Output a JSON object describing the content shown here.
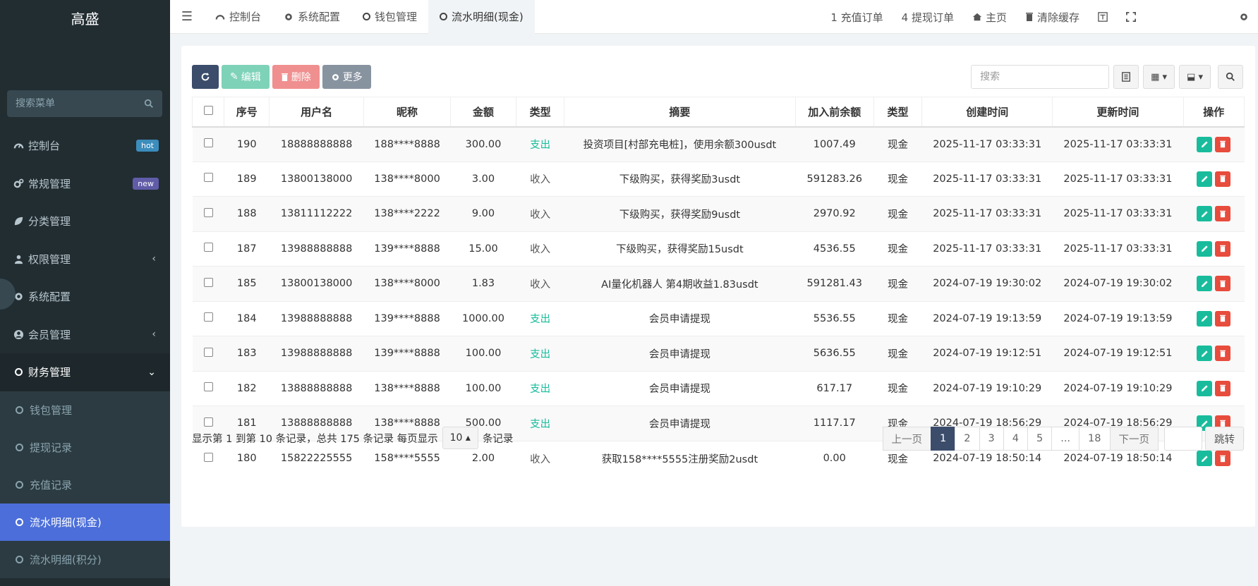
{
  "sidebar": {
    "brand": "高盛",
    "search_placeholder": "搜索菜单",
    "items": [
      {
        "label": "控制台",
        "badge": "hot",
        "badge_color": "#3c8dbc"
      },
      {
        "label": "常规管理",
        "badge": "new",
        "badge_color": "#605ca8"
      },
      {
        "label": "分类管理"
      },
      {
        "label": "权限管理"
      },
      {
        "label": "系统配置"
      },
      {
        "label": "会员管理"
      },
      {
        "label": "财务管理"
      }
    ],
    "submenu": [
      {
        "label": "钱包管理"
      },
      {
        "label": "提现记录"
      },
      {
        "label": "充值记录"
      },
      {
        "label": "流水明细(现金)"
      },
      {
        "label": "流水明细(积分)"
      }
    ]
  },
  "topnav": {
    "tabs": [
      "控制台",
      "系统配置",
      "钱包管理",
      "流水明细(现金)"
    ],
    "right": {
      "recharge": "1 充值订单",
      "withdraw": "4 提现订单",
      "home": "主页",
      "clear_cache": "清除缓存"
    }
  },
  "toolbar": {
    "edit": "编辑",
    "delete": "删除",
    "more": "更多",
    "search_placeholder": "搜索"
  },
  "table": {
    "headers": [
      "序号",
      "用户名",
      "昵称",
      "金额",
      "类型",
      "摘要",
      "加入前余额",
      "类型",
      "创建时间",
      "更新时间",
      "操作"
    ],
    "rows": [
      {
        "id": "190",
        "user": "18888888888",
        "nick": "188****8888",
        "amount": "300.00",
        "type": "支出",
        "summary": "投资项目[村部充电桩]，使用余额300usdt",
        "before": "1007.49",
        "type2": "现金",
        "created": "2025-11-17 03:33:31",
        "updated": "2025-11-17 03:33:31"
      },
      {
        "id": "189",
        "user": "13800138000",
        "nick": "138****8000",
        "amount": "3.00",
        "type": "收入",
        "summary": "下级购买，获得奖励3usdt",
        "before": "591283.26",
        "type2": "现金",
        "created": "2025-11-17 03:33:31",
        "updated": "2025-11-17 03:33:31"
      },
      {
        "id": "188",
        "user": "13811112222",
        "nick": "138****2222",
        "amount": "9.00",
        "type": "收入",
        "summary": "下级购买，获得奖励9usdt",
        "before": "2970.92",
        "type2": "现金",
        "created": "2025-11-17 03:33:31",
        "updated": "2025-11-17 03:33:31"
      },
      {
        "id": "187",
        "user": "13988888888",
        "nick": "139****8888",
        "amount": "15.00",
        "type": "收入",
        "summary": "下级购买，获得奖励15usdt",
        "before": "4536.55",
        "type2": "现金",
        "created": "2025-11-17 03:33:31",
        "updated": "2025-11-17 03:33:31"
      },
      {
        "id": "185",
        "user": "13800138000",
        "nick": "138****8000",
        "amount": "1.83",
        "type": "收入",
        "summary": "AI量化机器人 第4期收益1.83usdt",
        "before": "591281.43",
        "type2": "现金",
        "created": "2024-07-19 19:30:02",
        "updated": "2024-07-19 19:30:02"
      },
      {
        "id": "184",
        "user": "13988888888",
        "nick": "139****8888",
        "amount": "1000.00",
        "type": "支出",
        "summary": "会员申请提现",
        "before": "5536.55",
        "type2": "现金",
        "created": "2024-07-19 19:13:59",
        "updated": "2024-07-19 19:13:59"
      },
      {
        "id": "183",
        "user": "13988888888",
        "nick": "139****8888",
        "amount": "100.00",
        "type": "支出",
        "summary": "会员申请提现",
        "before": "5636.55",
        "type2": "现金",
        "created": "2024-07-19 19:12:51",
        "updated": "2024-07-19 19:12:51"
      },
      {
        "id": "182",
        "user": "13888888888",
        "nick": "138****8888",
        "amount": "100.00",
        "type": "支出",
        "summary": "会员申请提现",
        "before": "617.17",
        "type2": "现金",
        "created": "2024-07-19 19:10:29",
        "updated": "2024-07-19 19:10:29"
      },
      {
        "id": "181",
        "user": "13888888888",
        "nick": "138****8888",
        "amount": "500.00",
        "type": "支出",
        "summary": "会员申请提现",
        "before": "1117.17",
        "type2": "现金",
        "created": "2024-07-19 18:56:29",
        "updated": "2024-07-19 18:56:29"
      },
      {
        "id": "180",
        "user": "15822225555",
        "nick": "158****5555",
        "amount": "2.00",
        "type": "收入",
        "summary": "获取158****5555注册奖励2usdt",
        "before": "0.00",
        "type2": "现金",
        "created": "2024-07-19 18:50:14",
        "updated": "2024-07-19 18:50:14"
      }
    ]
  },
  "footer": {
    "info_prefix": "显示第 1 到第 10 条记录，总共 175 条记录 每页显示",
    "page_size": "10",
    "info_suffix": "条记录"
  },
  "pagination": {
    "prev": "上一页",
    "pages": [
      "1",
      "2",
      "3",
      "4",
      "5",
      "...",
      "18"
    ],
    "active": "1",
    "next": "下一页",
    "jump": "跳转"
  },
  "colors": {
    "sidebar_bg": "#222d32",
    "active_menu": "#4b6eda",
    "expense": "#18bc9c",
    "edit": "#18bc9c",
    "delete": "#e74c3c"
  }
}
